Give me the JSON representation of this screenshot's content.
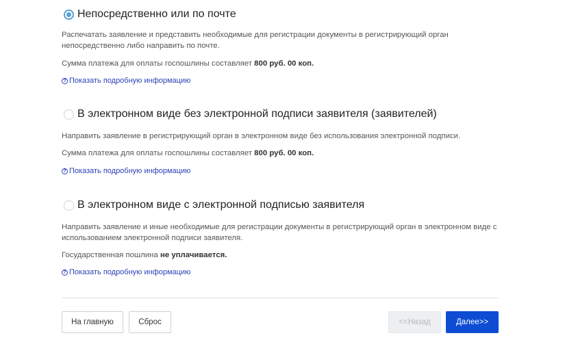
{
  "options": [
    {
      "title": "Непосредственно или по почте",
      "selected": true,
      "desc_lines": [
        "Распечатать заявление и представить необходимые для регистрации документы в регистрирующий орган",
        "непосредственно либо направить по почте."
      ],
      "fee_prefix": "Сумма платежа для оплаты госпошлины составляет ",
      "fee_bold": "800 руб. 00 коп.",
      "fee_suffix": "",
      "more_link": "Показать подробную информацию"
    },
    {
      "title": "В электронном виде без электронной подписи заявителя (заявителей)",
      "selected": false,
      "desc_lines": [
        "Направить заявление в регистрирующий орган в электронном виде без использования электронной подписи."
      ],
      "fee_prefix": "Сумма платежа для оплаты госпошлины составляет ",
      "fee_bold": "800 руб. 00 коп.",
      "fee_suffix": "",
      "more_link": "Показать подробную информацию"
    },
    {
      "title": "В электронном виде с электронной подписью заявителя",
      "selected": false,
      "desc_lines": [
        "Направить заявление и иные необходимые для регистрации документы в регистрирующий орган в электронном виде с",
        "использованием электронной подписи заявителя."
      ],
      "fee_prefix": "Государственная пошлина ",
      "fee_bold": "не уплачивается.",
      "fee_suffix": "",
      "more_link": "Показать подробную информацию"
    }
  ],
  "info_icon_glyph": "?",
  "buttons": {
    "home": "На главную",
    "reset": "Сброс",
    "back": "<<Назад",
    "next": "Далее>>"
  },
  "colors": {
    "accent": "#5a9fd4",
    "link": "#2b40b5",
    "primary_button": "#0d4cd3",
    "disabled_button": "#edeff1"
  }
}
